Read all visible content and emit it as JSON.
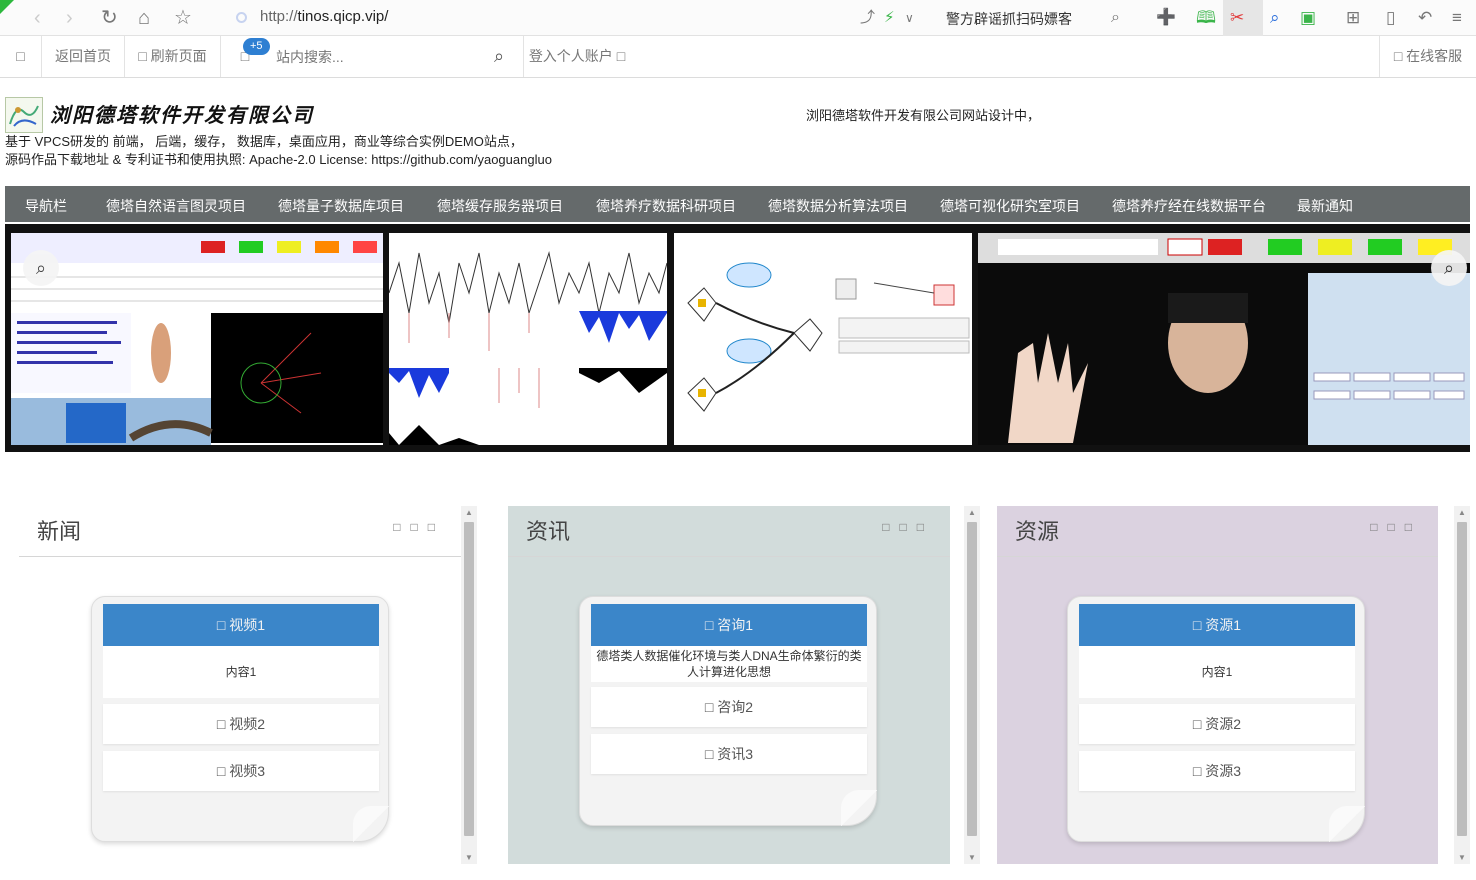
{
  "browser": {
    "url_prefix": "http://",
    "url_host": "tinos.qicp.vip/",
    "news_text": "警方辟谣抓扫码嫖客"
  },
  "toolbar": {
    "menu_icon": "□",
    "home_label": "返回首页",
    "refresh_label": "□ 刷新页面",
    "msg_icon": "□",
    "badge": "+5",
    "search_placeholder": "站内搜索...",
    "login_label": "登入个人账户 □",
    "service_label": "□ 在线客服"
  },
  "header": {
    "company_logo_text": "浏阳德塔软件开发有限公司",
    "desc_line1": "基于 VPCS研发的 前端， 后端，缓存， 数据库，桌面应用，商业等综合实例DEMO站点，",
    "desc_line2": "源码作品下载地址 & 专利证书和使用执照: Apache-2.0 License: https://github.com/yaoguangluo",
    "right_text": "浏阳德塔软件开发有限公司网站设计中，"
  },
  "nav": {
    "items": [
      "导航栏",
      "德塔自然语言图灵项目",
      "德塔量子数据库项目",
      "德塔缓存服务器项目",
      "德塔养疗数据科研项目",
      "德塔数据分析算法项目",
      "德塔可视化研究室项目",
      "德塔养疗经在线数据平台",
      "最新通知"
    ]
  },
  "panels": [
    {
      "title": "新闻",
      "dots": "□□□",
      "head": "□  视频1",
      "body": "内容1",
      "items": [
        "□  视频2",
        "□  视频3"
      ]
    },
    {
      "title": "资讯",
      "dots": "□□□",
      "head": "□  咨询1",
      "body": "德塔类人数据催化环境与类人DNA生命体繁衍的类人计算进化思想",
      "items": [
        "□  咨询2",
        "□  资讯3"
      ]
    },
    {
      "title": "资源",
      "dots": "□□□",
      "head": "□  资源1",
      "body": "内容1",
      "items": [
        "□  资源2",
        "□  资源3"
      ]
    }
  ],
  "colors": {
    "nav_bg": "#656a6b",
    "accordion_head": "#3b86c9",
    "panel2_bg": "#d2dcdb",
    "panel3_bg": "#dbd2e0"
  }
}
